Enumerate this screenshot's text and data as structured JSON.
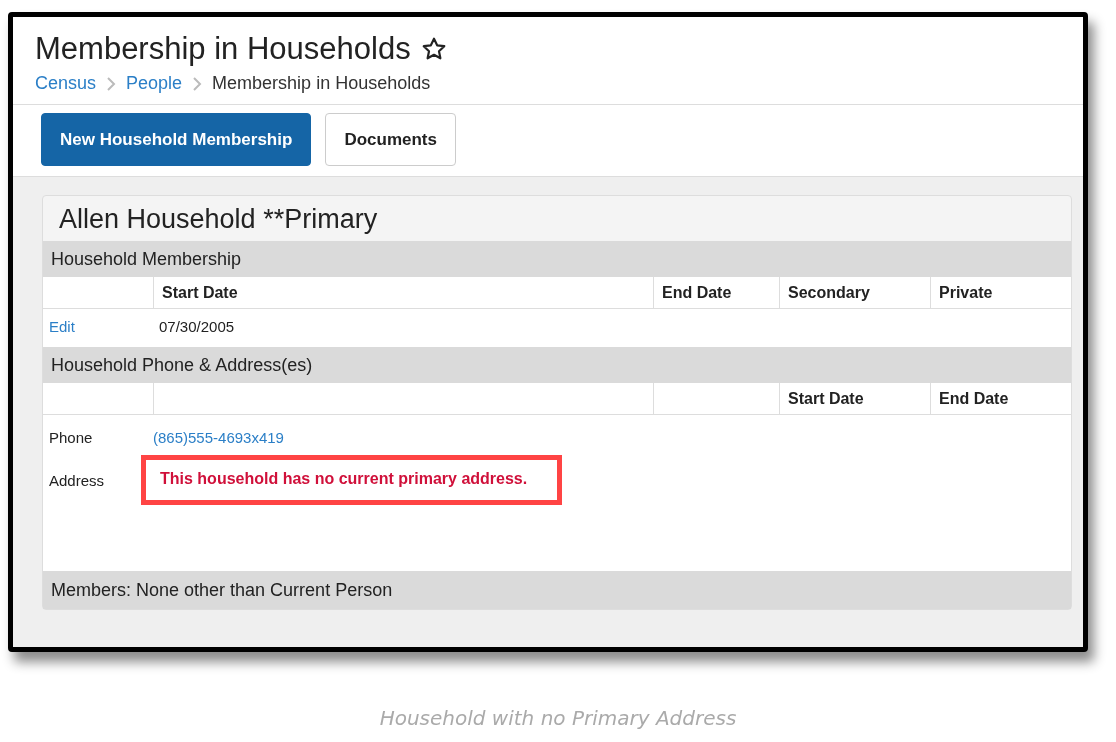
{
  "page": {
    "title": "Membership in Households",
    "favorite": false,
    "breadcrumbs": [
      {
        "label": "Census",
        "link": true
      },
      {
        "label": "People",
        "link": true
      },
      {
        "label": "Membership in Households",
        "link": false
      }
    ]
  },
  "toolbar": {
    "buttons": [
      {
        "label": "New Household Membership",
        "primary": true
      },
      {
        "label": "Documents",
        "primary": false
      }
    ]
  },
  "household": {
    "title": "Allen Household **Primary",
    "membership": {
      "heading": "Household Membership",
      "columns": [
        "",
        "Start Date",
        "End Date",
        "Secondary",
        "Private"
      ],
      "rows": [
        {
          "action": "Edit",
          "cells": [
            "07/30/2005",
            "",
            "",
            ""
          ]
        }
      ]
    },
    "contact": {
      "heading": "Household Phone & Address(es)",
      "columns": [
        "",
        "",
        "",
        "Start Date",
        "End Date"
      ],
      "rows": [
        {
          "kind": "link",
          "label": "Phone",
          "value": "(865)555-4693x419",
          "highlighted": false
        },
        {
          "kind": "warning",
          "label": "Address",
          "value": "This household has no current primary address.",
          "highlighted": true
        }
      ]
    },
    "members": "Members: None other than Current Person"
  },
  "caption": "Household with no Primary Address"
}
